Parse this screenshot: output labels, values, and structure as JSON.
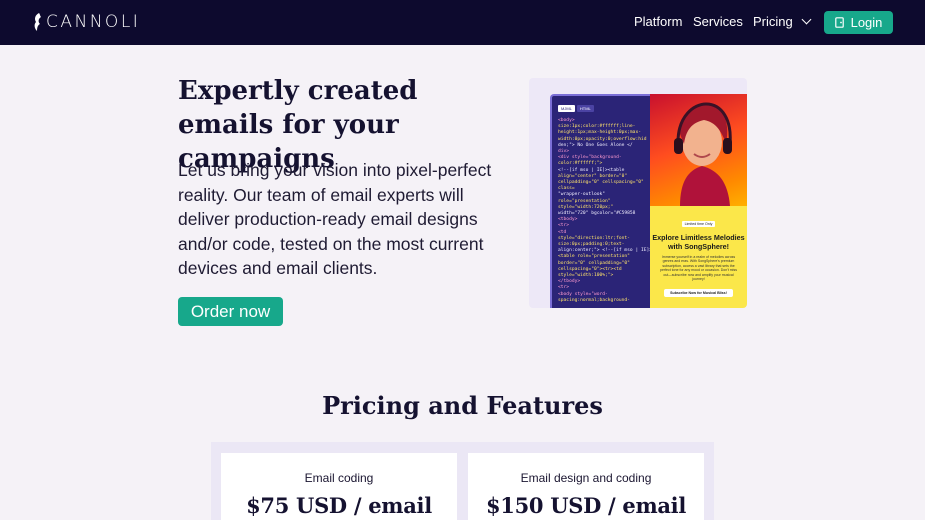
{
  "nav": {
    "logo_text": "CANNOLI",
    "links": [
      "Platform",
      "Services",
      "Pricing"
    ],
    "login_label": "Login"
  },
  "hero": {
    "title": "Expertly created emails for your campaigns",
    "body": "Let us bring your vision into pixel-perfect reality. Our team of email experts will deliver production-ready email designs and/or code, tested on the most current devices and email clients.",
    "cta_label": "Order now",
    "preview": {
      "tabs": [
        "MJML",
        "HTML"
      ],
      "code_lines": [
        "<body>",
        "size:1px;color:#ffffff;line-",
        "height:1px;max-height:0px;max-",
        "width:0px;opacity:0;overflow:hid",
        "den;\"> No One Goes Alone </",
        "div>",
        "<div style=\"background-",
        "color:#ffffff;\">",
        "<!--[if mso | IE]><table",
        "align=\"center\" border=\"0\"",
        "cellpadding=\"0\" cellspacing=\"0\"",
        "class=",
        "\"wrapper-outlook\"",
        "role=\"presentation\"",
        "style=\"width:720px;\"",
        "width=\"720\" bgcolor=\"#C59858",
        "<tbody>",
        "<tr>",
        "<td",
        "style=\"direction:ltr;font-",
        "size:0px;padding:0;text-",
        "align:center;\"> <!--[if mso | IE]>",
        "<table role=\"presentation\"",
        "border=\"0\" cellpadding=\"0\"",
        "cellspacing=\"0\"><tr><td",
        "style=\"width:100%;\">",
        "</tbody>",
        "<tr>",
        "<body style=\"word-",
        "spacing:normal;background-"
      ],
      "badge": "Limited time Only",
      "heading": "Explore Limitless Melodies with SongSphere!",
      "copy": "Immerse yourself in a realm of melodies across genres and eras. With SongSphere's premium subscription, access a vast library that sets the perfect tone for any mood or occasion. Don't miss out—subscribe now and amplify your musical journey!",
      "cta": "Subscribe Now for Musical Bliss!"
    }
  },
  "pricing": {
    "title": "Pricing and Features",
    "plans": [
      {
        "label": "Email coding",
        "price": "$75 USD / email"
      },
      {
        "label": "Email design and coding",
        "price": "$150 USD / email"
      }
    ]
  },
  "colors": {
    "nav_bg": "#0d0a2e",
    "accent": "#17a88b",
    "page_bg": "#f5f2f7"
  },
  "icons": [
    "cannoli-logo-icon",
    "chevron-down-icon",
    "login-icon"
  ]
}
